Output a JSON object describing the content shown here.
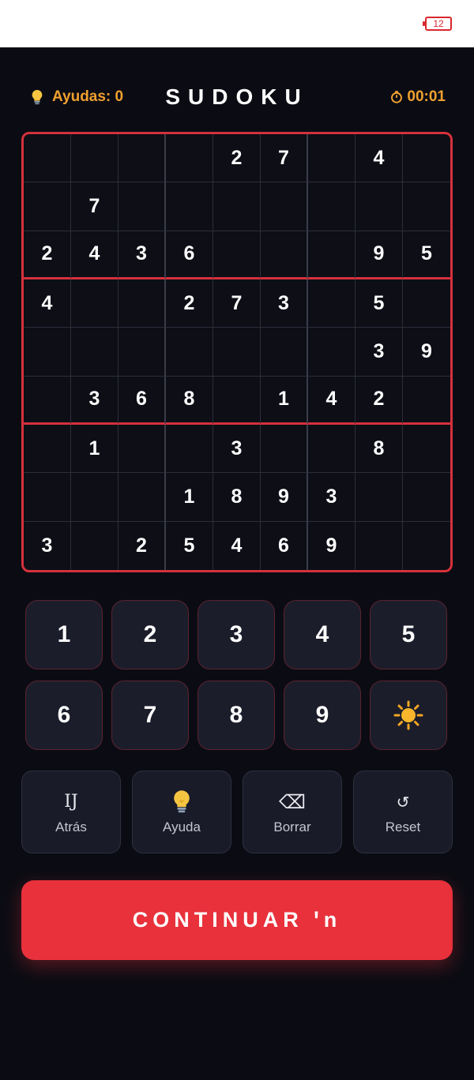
{
  "status_bar": {
    "battery": "12"
  },
  "header": {
    "hints_label": "Ayudas: 0",
    "title": "SUDOKU",
    "timer": "00:01",
    "accent_color": "#f0a030"
  },
  "board": {
    "grid": [
      [
        "",
        "",
        "",
        "",
        "2",
        "7",
        "",
        "4",
        ""
      ],
      [
        "",
        "7",
        "",
        "",
        "",
        "",
        "",
        "",
        ""
      ],
      [
        "2",
        "4",
        "3",
        "6",
        "",
        "",
        "",
        "9",
        "5"
      ],
      [
        "4",
        "",
        "",
        "2",
        "7",
        "3",
        "",
        "5",
        ""
      ],
      [
        "",
        "",
        "",
        "",
        "",
        "",
        "",
        "3",
        "9"
      ],
      [
        "",
        "3",
        "6",
        "8",
        "",
        "1",
        "4",
        "2",
        ""
      ],
      [
        "",
        "1",
        "",
        "",
        "3",
        "",
        "",
        "8",
        ""
      ],
      [
        "",
        "",
        "",
        "1",
        "8",
        "9",
        "3",
        "",
        ""
      ],
      [
        "3",
        "",
        "2",
        "5",
        "4",
        "6",
        "9",
        "",
        ""
      ]
    ],
    "border_color": "#d5313c"
  },
  "numpad": {
    "keys": [
      "1",
      "2",
      "3",
      "4",
      "5",
      "6",
      "7",
      "8",
      "9"
    ],
    "extra_icon": "sun-icon"
  },
  "actions": [
    {
      "label": "Atrás",
      "icon_glyph": "IJ",
      "icon": "undo-icon"
    },
    {
      "label": "Ayuda",
      "icon_glyph": "",
      "icon": "lightbulb-icon"
    },
    {
      "label": "Borrar",
      "icon_glyph": "⌫",
      "icon": "backspace-icon"
    },
    {
      "label": "Reset",
      "icon_glyph": "↺",
      "icon": "reset-icon"
    }
  ],
  "continue_button": {
    "label": "CONTINUAR ꞌn",
    "color": "#e8313b"
  }
}
